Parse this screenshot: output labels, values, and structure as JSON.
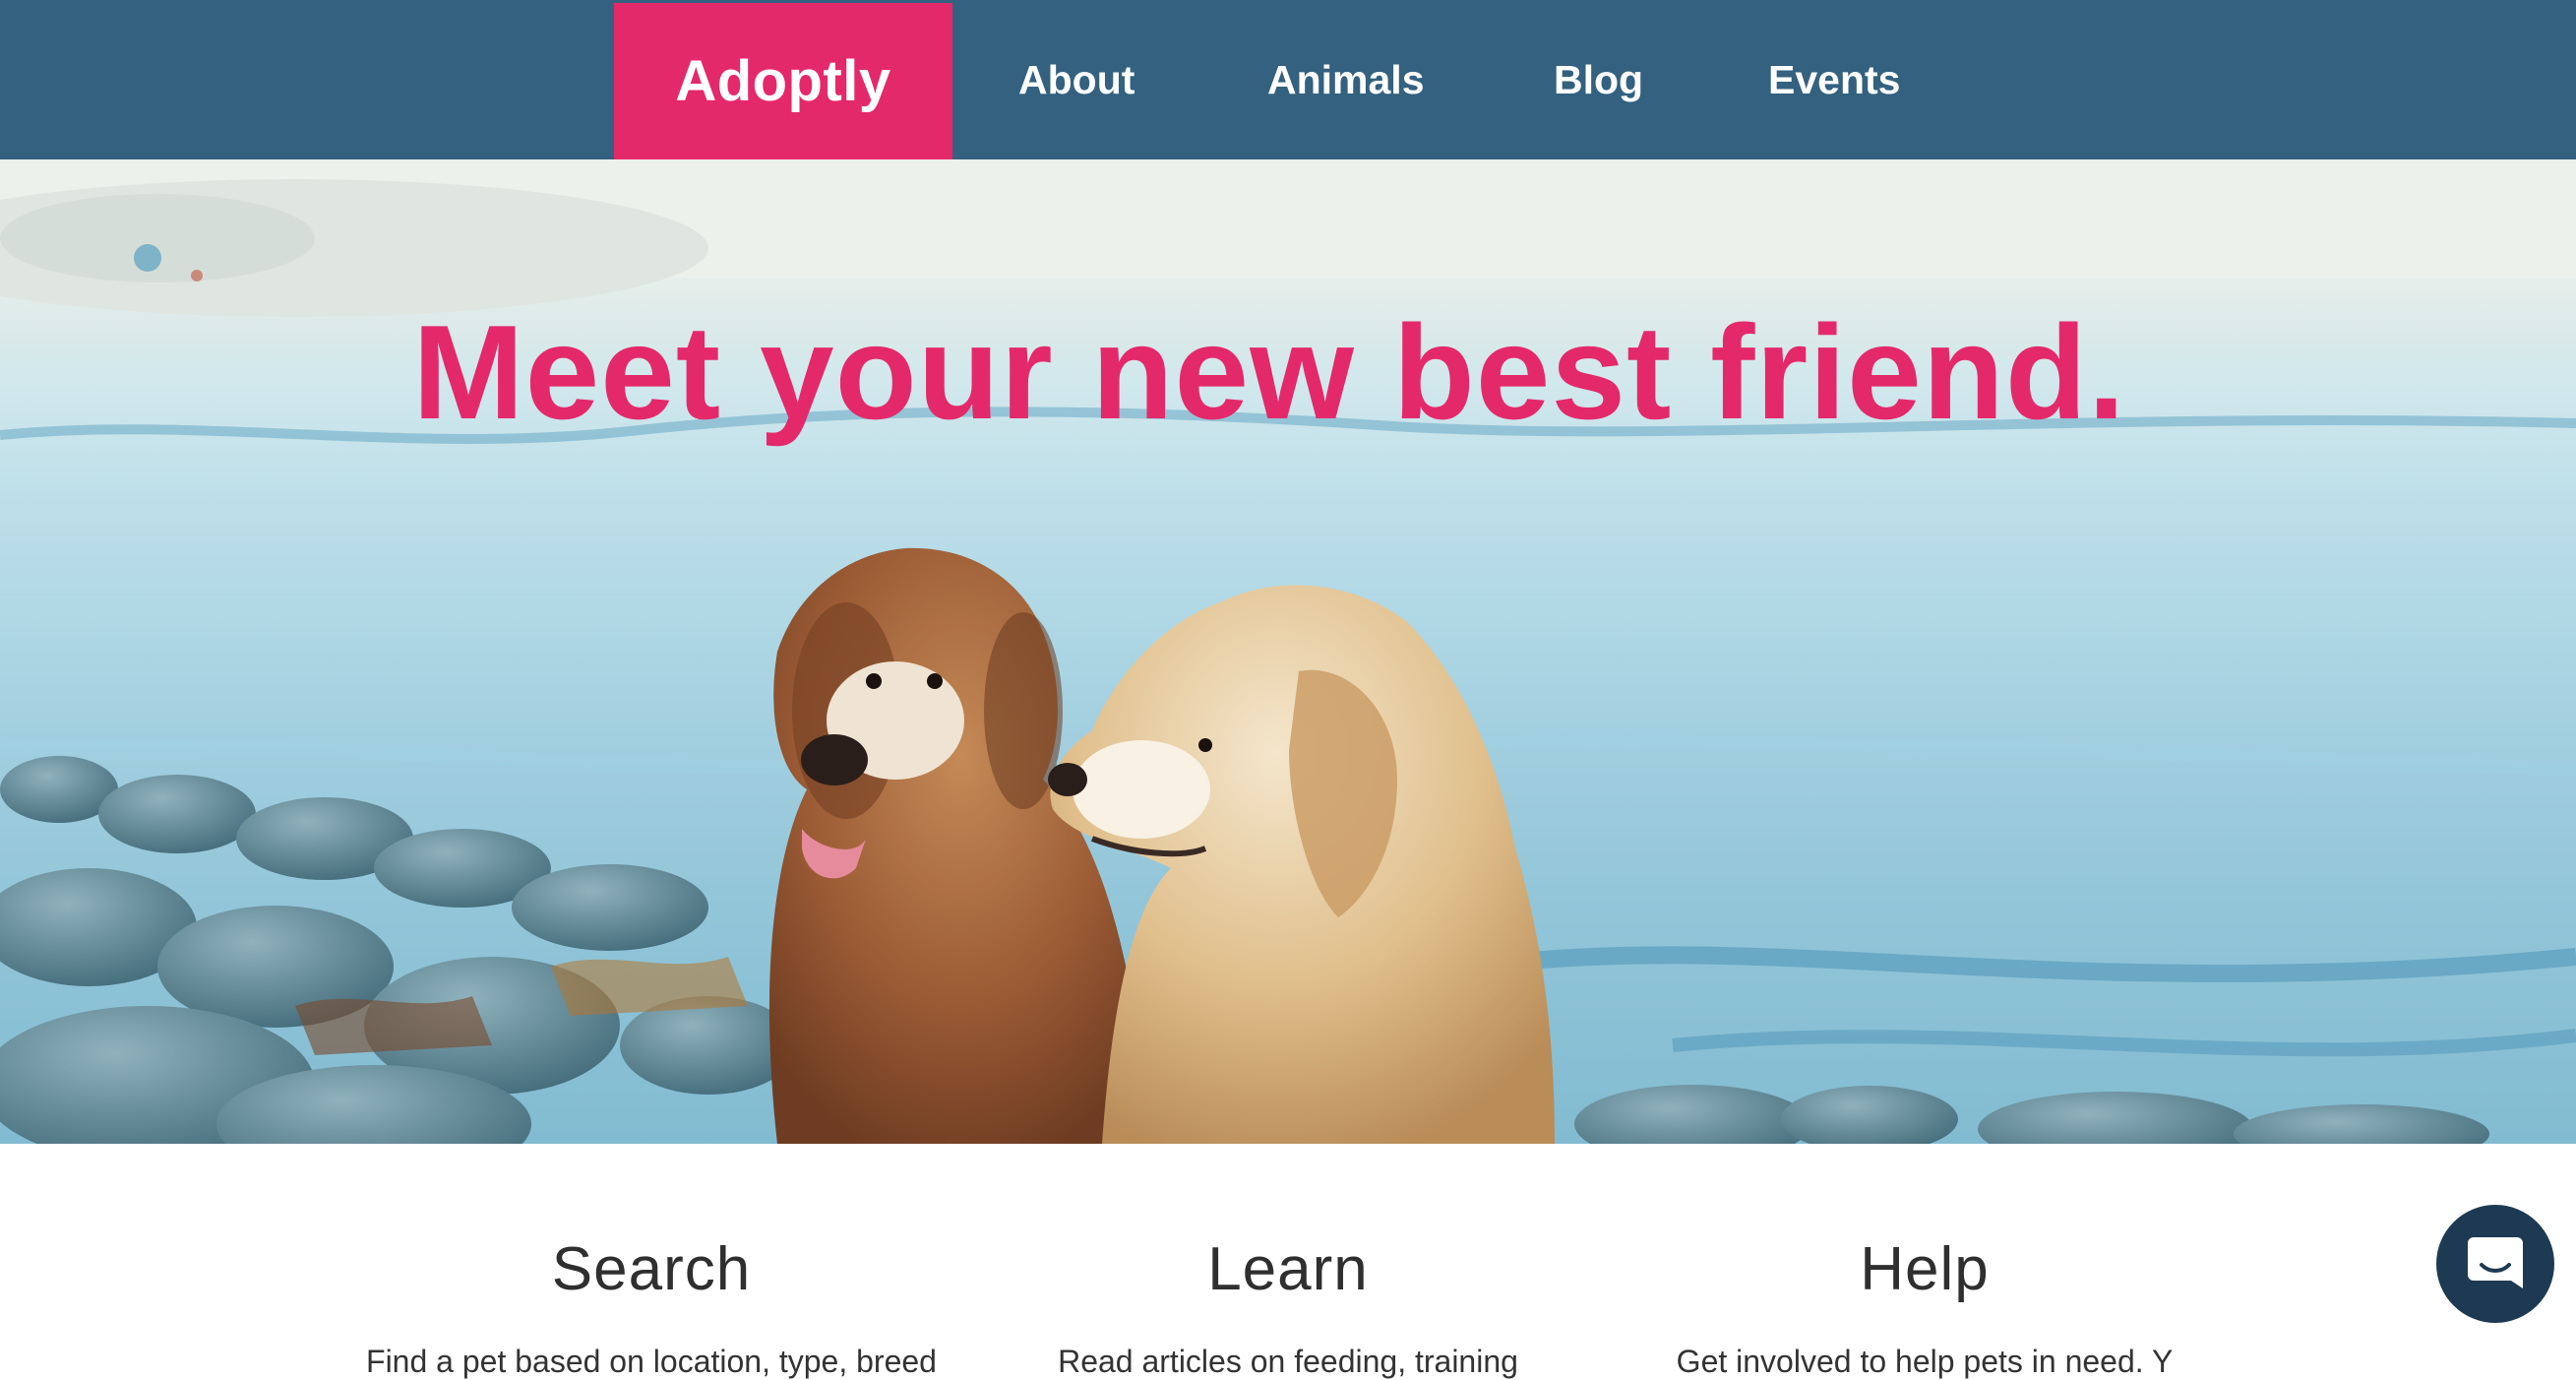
{
  "nav": {
    "brand": "Adoptly",
    "links": [
      {
        "label": "About"
      },
      {
        "label": "Animals"
      },
      {
        "label": "Blog"
      },
      {
        "label": "Events"
      }
    ]
  },
  "hero": {
    "headline": "Meet your new best friend.",
    "image": "two-golden-retrievers-on-rocky-beach"
  },
  "features": [
    {
      "title": "Search",
      "description": "Find a pet based on location, type, breed"
    },
    {
      "title": "Learn",
      "description": "Read articles on feeding, training"
    },
    {
      "title": "Help",
      "description": "Get involved to help pets in need. Y"
    }
  ],
  "chat": {
    "icon": "chat-bubble-icon"
  },
  "colors": {
    "nav_background": "#33617f",
    "brand_accent": "#e4296a",
    "chat_button": "#1d3a52"
  }
}
